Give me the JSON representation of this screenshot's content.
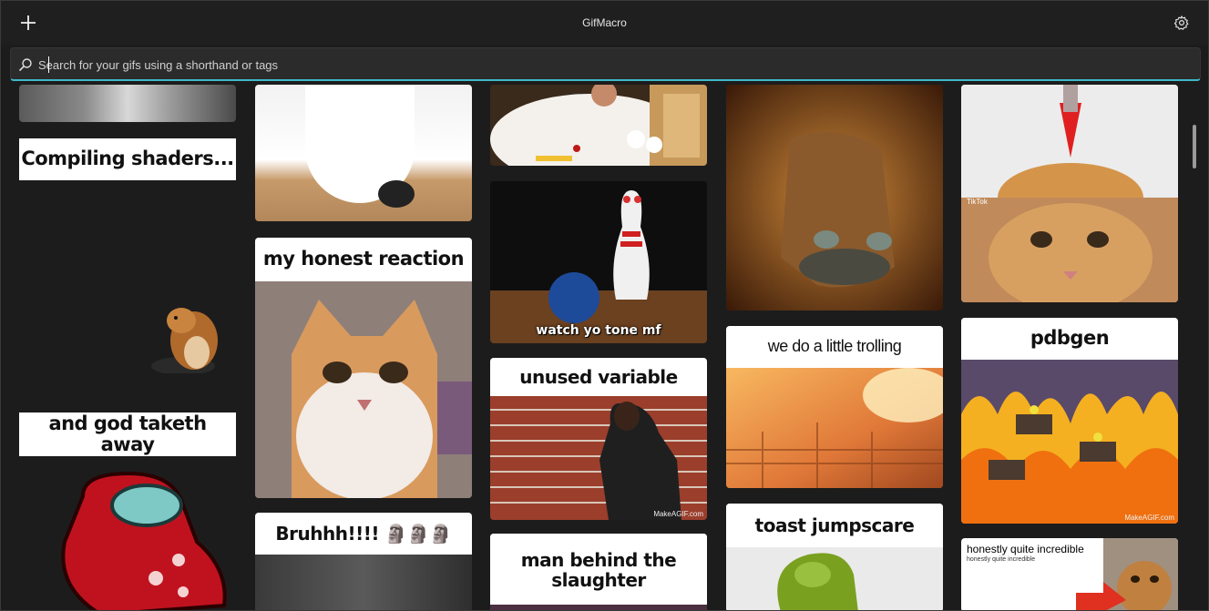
{
  "app": {
    "title": "GifMacro"
  },
  "search": {
    "placeholder": "Search for your gifs using a shorthand or tags",
    "value": ""
  },
  "colors": {
    "accent": "#3fb8c8",
    "background": "#1c1c1c"
  },
  "icons": {
    "add": "plus-icon",
    "settings": "gear-icon",
    "search": "search-icon"
  },
  "gifs": [
    {
      "caption": "Compiling shaders..."
    },
    {
      "caption": "and god taketh away"
    },
    {
      "caption": "my honest reaction"
    },
    {
      "caption": "Bruhhh!!!! 🗿🗿🗿"
    },
    {
      "caption": "watch yo tone mf"
    },
    {
      "caption": "unused variable",
      "watermark": "MakeAGIF.com"
    },
    {
      "caption": "man behind the slaughter"
    },
    {
      "caption": "we do a little trolling"
    },
    {
      "caption": "toast jumpscare"
    },
    {
      "caption": "pdbgen",
      "watermark": "MakeAGIF.com"
    },
    {
      "caption": "honestly quite incredible",
      "subcaption": "honestly quite incredible"
    },
    {
      "watermark": "TikTok"
    }
  ]
}
